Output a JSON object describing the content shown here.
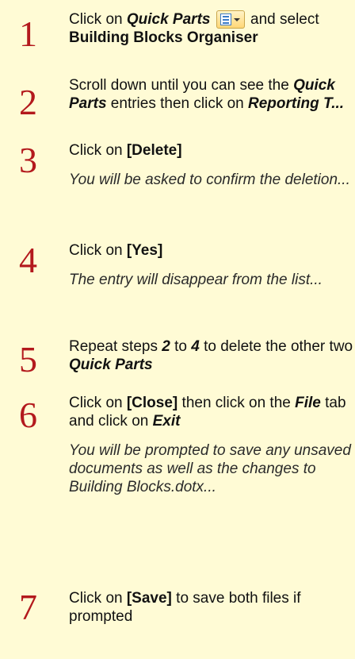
{
  "steps": [
    {
      "number": "1",
      "parts": {
        "a": "Click on ",
        "b": "Quick Parts",
        "c": " and select ",
        "d": "Building Blocks Organiser"
      },
      "icon": "quick-parts-dropdown-icon"
    },
    {
      "number": "2",
      "parts": {
        "a": "Scroll down until you can see the ",
        "b": "Quick Parts",
        "c": " entries then click on ",
        "d": "Reporting T..."
      }
    },
    {
      "number": "3",
      "parts": {
        "a": "Click on ",
        "b": "[Delete]"
      },
      "note": "You will be asked to confirm the deletion..."
    },
    {
      "number": "4",
      "parts": {
        "a": "Click on ",
        "b": "[Yes]"
      },
      "note": "The entry will disappear from the list..."
    },
    {
      "number": "5",
      "parts": {
        "a": "Repeat steps ",
        "b": "2",
        "c": " to ",
        "d": "4",
        "e": " to delete the other two ",
        "f": "Quick Parts"
      }
    },
    {
      "number": "6",
      "parts": {
        "a": "Click on ",
        "b": "[Close]",
        "c": " then click on the ",
        "d": "File",
        "e": " tab and click on ",
        "f": "Exit"
      },
      "note": "You will be prompted to save any unsaved documents as well as the changes to Building Blocks.dotx..."
    },
    {
      "number": "7",
      "parts": {
        "a": "Click on ",
        "b": "[Save]",
        "c": " to save both files if prompted"
      }
    }
  ],
  "colors": {
    "background": "#fffbd5",
    "step_number": "#b3191d"
  }
}
